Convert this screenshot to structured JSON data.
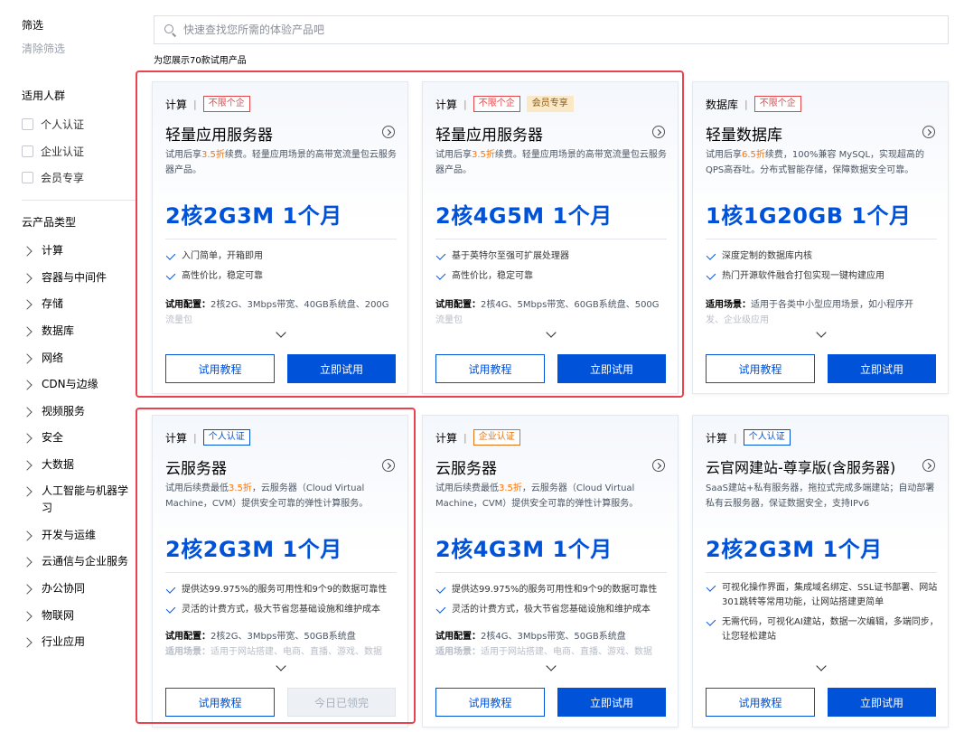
{
  "sidebar": {
    "title": "筛选",
    "clear": "清除筛选",
    "audience_title": "适用人群",
    "audience": [
      "个人认证",
      "企业认证",
      "会员专享"
    ],
    "category_title": "云产品类型",
    "categories": [
      "计算",
      "容器与中间件",
      "存储",
      "数据库",
      "网络",
      "CDN与边缘",
      "视频服务",
      "安全",
      "大数据",
      "人工智能与机器学习",
      "开发与运维",
      "云通信与企业服务",
      "办公协同",
      "物联网",
      "行业应用"
    ]
  },
  "search": {
    "placeholder": "快速查找您所需的体验产品吧"
  },
  "count_text": "为您展示70款试用产品",
  "buttons": {
    "tutorial": "试用教程",
    "try_now": "立即试用",
    "claimed": "今日已领完"
  },
  "config_label": "试用配置：",
  "scene_label": "适用场景：",
  "cards": [
    {
      "category": "计算",
      "tags": [
        "不限个企"
      ],
      "title": "轻量应用服务器",
      "desc_pre": "试用后享",
      "desc_hl": "3.5折",
      "desc_post": "续费。轻量应用场景的高带宽流量包云服务器产品。",
      "spec": "2核2G3M  1个月",
      "features": [
        "入门简单，开箱即用",
        "高性价比，稳定可靠"
      ],
      "config": "2核2G、3Mbps带宽、40GB系统盘、200G",
      "config_more": "流量包"
    },
    {
      "category": "计算",
      "tags": [
        "不限个企",
        "会员专享"
      ],
      "title": "轻量应用服务器",
      "desc_pre": "试用后享",
      "desc_hl": "3.5折",
      "desc_post": "续费。轻量应用场景的高带宽流量包云服务器产品。",
      "spec": "2核4G5M  1个月",
      "features": [
        "基于英特尔至强可扩展处理器",
        "高性价比，稳定可靠"
      ],
      "config": "2核4G、5Mbps带宽、60GB系统盘、500G",
      "config_more": "流量包"
    },
    {
      "category": "数据库",
      "tags": [
        "不限个企"
      ],
      "title": "轻量数据库",
      "desc_pre": "试用后享",
      "desc_hl": "6.5折",
      "desc_post": "续费，100%兼容 MySQL，实现超高的QPS高吞吐。分布式智能存储，保障数据安全可靠。",
      "spec": "1核1G20GB  1个月",
      "features": [
        "深度定制的数据库内核",
        "热门开源软件融合打包实现一键构建应用"
      ],
      "scene": "适用于各类中小型应用场景，如小程序开",
      "scene_more": "发、企业级应用"
    },
    {
      "category": "计算",
      "tags": [
        "个人认证"
      ],
      "title": "云服务器",
      "desc_pre": "试用后续费最低",
      "desc_hl": "3.5折",
      "desc_post": "，云服务器（Cloud Virtual Machine，CVM）提供安全可靠的弹性计算服务。",
      "spec": "2核2G3M  1个月",
      "features": [
        "提供达99.975%的服务可用性和9个9的数据可靠性",
        "灵活的计费方式，极大节省您基础设施和维护成本"
      ],
      "config": "2核2G、3Mbps带宽、50GB系统盘",
      "scene": "适用于网站搭建、电商、直播、游戏、数据"
    },
    {
      "category": "计算",
      "tags": [
        "企业认证"
      ],
      "title": "云服务器",
      "desc_pre": "试用后续费最低",
      "desc_hl": "3.5折",
      "desc_post": "，云服务器（Cloud Virtual Machine，CVM）提供安全可靠的弹性计算服务。",
      "spec": "2核4G3M  1个月",
      "features": [
        "提供达99.975%的服务可用性和9个9的数据可靠性",
        "灵活的计费方式，极大节省您基础设施和维护成本"
      ],
      "config": "2核4G、3Mbps带宽、50GB系统盘",
      "scene": "适用于网站搭建、电商、直播、游戏、数据"
    },
    {
      "category": "计算",
      "tags": [
        "个人认证"
      ],
      "title": "云官网建站-尊享版(含服务器)",
      "desc_pre": "SaaS建站+私有服务器，拖拉式完成多端建站；自动部署私有云服务器，保证数据安全，支持IPv6",
      "desc_hl": "",
      "desc_post": "",
      "spec": "2核2G3M  1个月",
      "features": [
        "可视化操作界面，集成域名绑定、SSL证书部署、网站301跳转等常用功能，让网站搭建更简单",
        "无需代码，可视化AI建站，数据一次编辑，多端同步，让您轻松建站"
      ]
    }
  ],
  "colors": {
    "primary": "#0052d9",
    "discount": "#ff7200",
    "highlight": "#e8434f"
  }
}
